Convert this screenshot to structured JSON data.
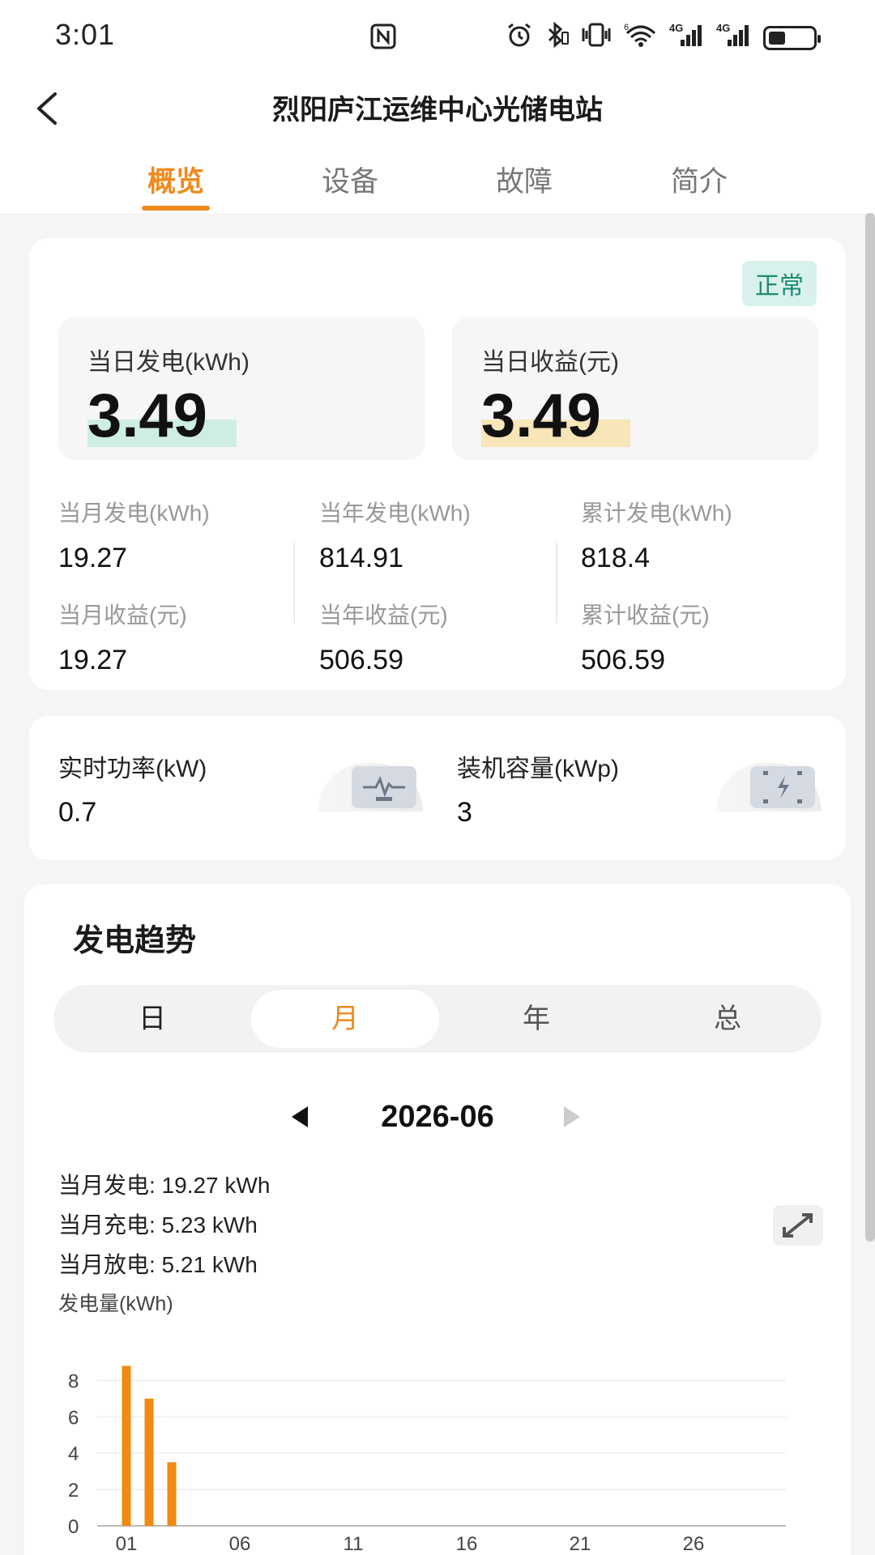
{
  "status_bar": {
    "time": "3:01",
    "icons": [
      "nfc-icon",
      "alarm-icon",
      "bluetooth-icon",
      "vibrate-icon",
      "wifi-6-icon",
      "signal-4g-icon",
      "signal-4g-icon",
      "battery-icon"
    ],
    "signal_label_1": "4G",
    "signal_label_2": "4G",
    "wifi_label": "6"
  },
  "header": {
    "title": "烈阳庐江运维中心光储电站",
    "back_icon": "chevron-left-icon"
  },
  "tabs": [
    {
      "label": "概览",
      "active": true
    },
    {
      "label": "设备",
      "active": false
    },
    {
      "label": "故障",
      "active": false
    },
    {
      "label": "简介",
      "active": false
    }
  ],
  "summary": {
    "status": "正常",
    "daily_generation": {
      "label": "当日发电(kWh)",
      "value": "3.49"
    },
    "daily_income": {
      "label": "当日收益(元)",
      "value": "3.49"
    },
    "stats": [
      {
        "label": "当月发电(kWh)",
        "value": "19.27"
      },
      {
        "label": "当年发电(kWh)",
        "value": "814.91"
      },
      {
        "label": "累计发电(kWh)",
        "value": "818.4"
      },
      {
        "label": "当月收益(元)",
        "value": "19.27"
      },
      {
        "label": "当年收益(元)",
        "value": "506.59"
      },
      {
        "label": "累计收益(元)",
        "value": "506.59"
      }
    ]
  },
  "realtime": {
    "power": {
      "label": "实时功率(kW)",
      "value": "0.7",
      "icon": "monitor-pulse-icon"
    },
    "capacity": {
      "label": "装机容量(kWp)",
      "value": "3",
      "icon": "battery-bolt-icon"
    }
  },
  "trend": {
    "title": "发电趋势",
    "periods": [
      {
        "label": "日",
        "active": false
      },
      {
        "label": "月",
        "active": true
      },
      {
        "label": "年",
        "active": false
      },
      {
        "label": "总",
        "active": false
      }
    ],
    "date": "2026-06",
    "month_generation": "当月发电: 19.27 kWh",
    "month_charge": "当月充电: 5.23 kWh",
    "month_discharge": "当月放电: 5.21 kWh",
    "unit_label": "发电量(kWh)",
    "expand_icon": "expand-arrows-icon"
  },
  "chart_data": {
    "type": "bar",
    "ylabel": "发电量(kWh)",
    "xlabel": "",
    "ylim": [
      0,
      9
    ],
    "yticks": [
      0,
      2,
      4,
      6,
      8
    ],
    "x": [
      "01",
      "02",
      "03",
      "04",
      "05",
      "06",
      "07",
      "08",
      "09",
      "10",
      "11",
      "12",
      "13",
      "14",
      "15",
      "16",
      "17",
      "18",
      "19",
      "20",
      "21",
      "22",
      "23",
      "24",
      "25",
      "26",
      "27",
      "28",
      "29",
      "30"
    ],
    "xtick_labels": [
      "01",
      "06",
      "11",
      "16",
      "21",
      "26"
    ],
    "values": [
      8.8,
      7.0,
      3.5,
      0,
      0,
      0,
      0,
      0,
      0,
      0,
      0,
      0,
      0,
      0,
      0,
      0,
      0,
      0,
      0,
      0,
      0,
      0,
      0,
      0,
      0,
      0,
      0,
      0,
      0,
      0
    ],
    "bar_color": "#f08a12",
    "grid": true
  },
  "colors": {
    "accent": "#ef8a1c",
    "status_ok_bg": "#d8f1ec",
    "status_ok_text": "#1f8a72"
  }
}
